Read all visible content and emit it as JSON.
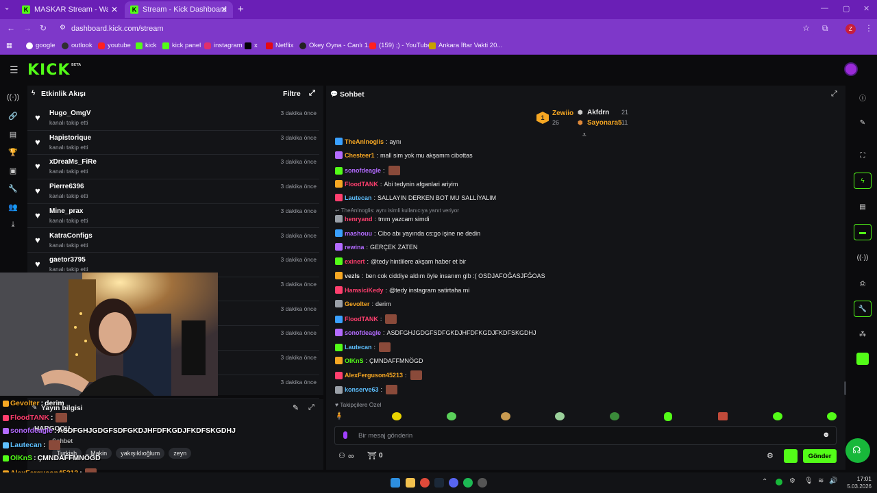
{
  "browser": {
    "tabs": [
      {
        "title": "MASKAR Stream - Watch Live o",
        "active": false
      },
      {
        "title": "Stream - Kick Dashboard",
        "active": true
      }
    ],
    "url": "dashboard.kick.com/stream",
    "profile_initial": "Z",
    "bookmarks": [
      "google",
      "outlook",
      "youtube",
      "kick",
      "kick panel",
      "instagram",
      "x",
      "Netflix",
      "Okey Oyna - Canlı 1...",
      "(159) ;) - YouTube",
      "Ankara İftar Vakti 20..."
    ]
  },
  "kick": {
    "logo": "KICK",
    "logo_tag": "BETA"
  },
  "events": {
    "title": "Etkinlik Akışı",
    "filter_label": "Filtre",
    "items": [
      {
        "name": "Hugo_OmgV",
        "action": "kanalı takip etti",
        "time": "3 dakika önce"
      },
      {
        "name": "Hapistorique",
        "action": "kanalı takip etti",
        "time": "3 dakika önce"
      },
      {
        "name": "xDreaMs_FiRe",
        "action": "kanalı takip etti",
        "time": "3 dakika önce"
      },
      {
        "name": "Pierre6396",
        "action": "kanalı takip etti",
        "time": "3 dakika önce"
      },
      {
        "name": "Mine_prax",
        "action": "kanalı takip etti",
        "time": "3 dakika önce"
      },
      {
        "name": "KatraConfigs",
        "action": "kanalı takip etti",
        "time": "3 dakika önce"
      },
      {
        "name": "gaetor3795",
        "action": "kanalı takip etti",
        "time": "3 dakika önce"
      },
      {
        "name": "",
        "action": "",
        "time": "3 dakika önce"
      },
      {
        "name": "",
        "action": "",
        "time": "3 dakika önce"
      },
      {
        "name": "",
        "action": "",
        "time": "3 dakika önce"
      },
      {
        "name": "",
        "action": "",
        "time": "3 dakika önce"
      },
      {
        "name": "",
        "action": "",
        "time": "3 dakika önce"
      }
    ]
  },
  "stream_info": {
    "title": "Yayın bilgisi",
    "stream_title": "HARGOOU",
    "category": "Sohbet",
    "tags": [
      "Turkish",
      "Makin",
      "yakışıklıoğlum",
      "zeyn"
    ]
  },
  "overlay_chat": [
    {
      "user": "Gevolter",
      "text": "derim",
      "color": "#f6a723"
    },
    {
      "user": "FloodTANK",
      "text": "",
      "color": "#ff3f6e"
    },
    {
      "user": "sonofdeagle",
      "text": "ASDFGHJGDGFSDFGKDJHFDFKGDJFKDFSKGDHJ",
      "color": "#b36bff"
    },
    {
      "user": "Lautecan",
      "text": "",
      "color": "#5ec0ff"
    },
    {
      "user": "OlKnS",
      "text": "ÇMNDAFFMNÖGD",
      "color": "#53fc18"
    },
    {
      "user": "AlexFerguson45213",
      "text": "",
      "color": "#f6a723"
    },
    {
      "user": "konserve63",
      "text": "",
      "color": "#5ec0ff"
    }
  ],
  "chat": {
    "title": "Sohbet",
    "leaderboard": [
      {
        "rank": "1",
        "name": "Zewiio",
        "count": "26"
      },
      {
        "rank": "",
        "name": "Akfdrn",
        "count": "21"
      },
      {
        "rank": "",
        "name": "Sayonara5",
        "count": "11"
      }
    ],
    "reply_note": "TheAnInoglis: aynı isimli kullanıcıya yanıt veriyor",
    "messages": [
      {
        "user": "TheAnInoglis",
        "text": "aynı",
        "color": "#f6a723"
      },
      {
        "user": "Chesteer1",
        "text": "mall sim yok mu akşamm cibottas",
        "color": "#f6a723"
      },
      {
        "user": "sonofdeagle",
        "text": "",
        "color": "#b36bff"
      },
      {
        "user": "FloodTANK",
        "text": "Abi tedynin afganlari ariyim",
        "color": "#ff3f6e"
      },
      {
        "user": "Lautecan",
        "text": "SALLAYIN DERKEN BOT MU SALLİYALIM",
        "color": "#5ec0ff"
      },
      {
        "user": "henryand",
        "text": "tmm yazcam simdi",
        "color": "#ff3f6e"
      },
      {
        "user": "mashouu",
        "text": "Cibo abı yayında cs:go işine ne dedin",
        "color": "#b36bff"
      },
      {
        "user": "rewina",
        "text": "GERÇEK ZATEN",
        "color": "#b36bff"
      },
      {
        "user": "exinert",
        "text": "@tedy hintlilere akşam haber et bir",
        "color": "#ff3f6e"
      },
      {
        "user": "vezls",
        "text": "ben cok ciddiye aldım öyle insanım glb :( OSDJAFOĞASJFĞOAS",
        "color": "#dddddd"
      },
      {
        "user": "HamsiciKedy",
        "text": "@tedy instagram satirtaha mi",
        "color": "#ff3f6e"
      },
      {
        "user": "Gevolter",
        "text": "derim",
        "color": "#f6a723"
      },
      {
        "user": "FloodTANK",
        "text": "",
        "color": "#ff3f6e"
      },
      {
        "user": "sonofdeagle",
        "text": "ASDFGHJGDGFSDFGKDJHFDFKGDJFKDFSKGDHJ",
        "color": "#b36bff"
      },
      {
        "user": "Lautecan",
        "text": "",
        "color": "#5ec0ff"
      },
      {
        "user": "OlKnS",
        "text": "ÇMNDAFFMNÖGD",
        "color": "#53fc18"
      },
      {
        "user": "AlexFerguson45213",
        "text": "",
        "color": "#f6a723"
      },
      {
        "user": "konserve63",
        "text": "",
        "color": "#5ec0ff"
      }
    ],
    "followers_label": "Takipçilere Özel",
    "input_placeholder": "Bir mesaj gönderin",
    "points": "∞",
    "gift_count": "0",
    "send_label": "Gönder"
  },
  "taskbar": {
    "time": "17:01",
    "date": "5.03.2026"
  },
  "colors": {
    "kick_green": "#53fc18",
    "chrome_purple": "#7e38c9",
    "panel_bg": "#131417"
  }
}
